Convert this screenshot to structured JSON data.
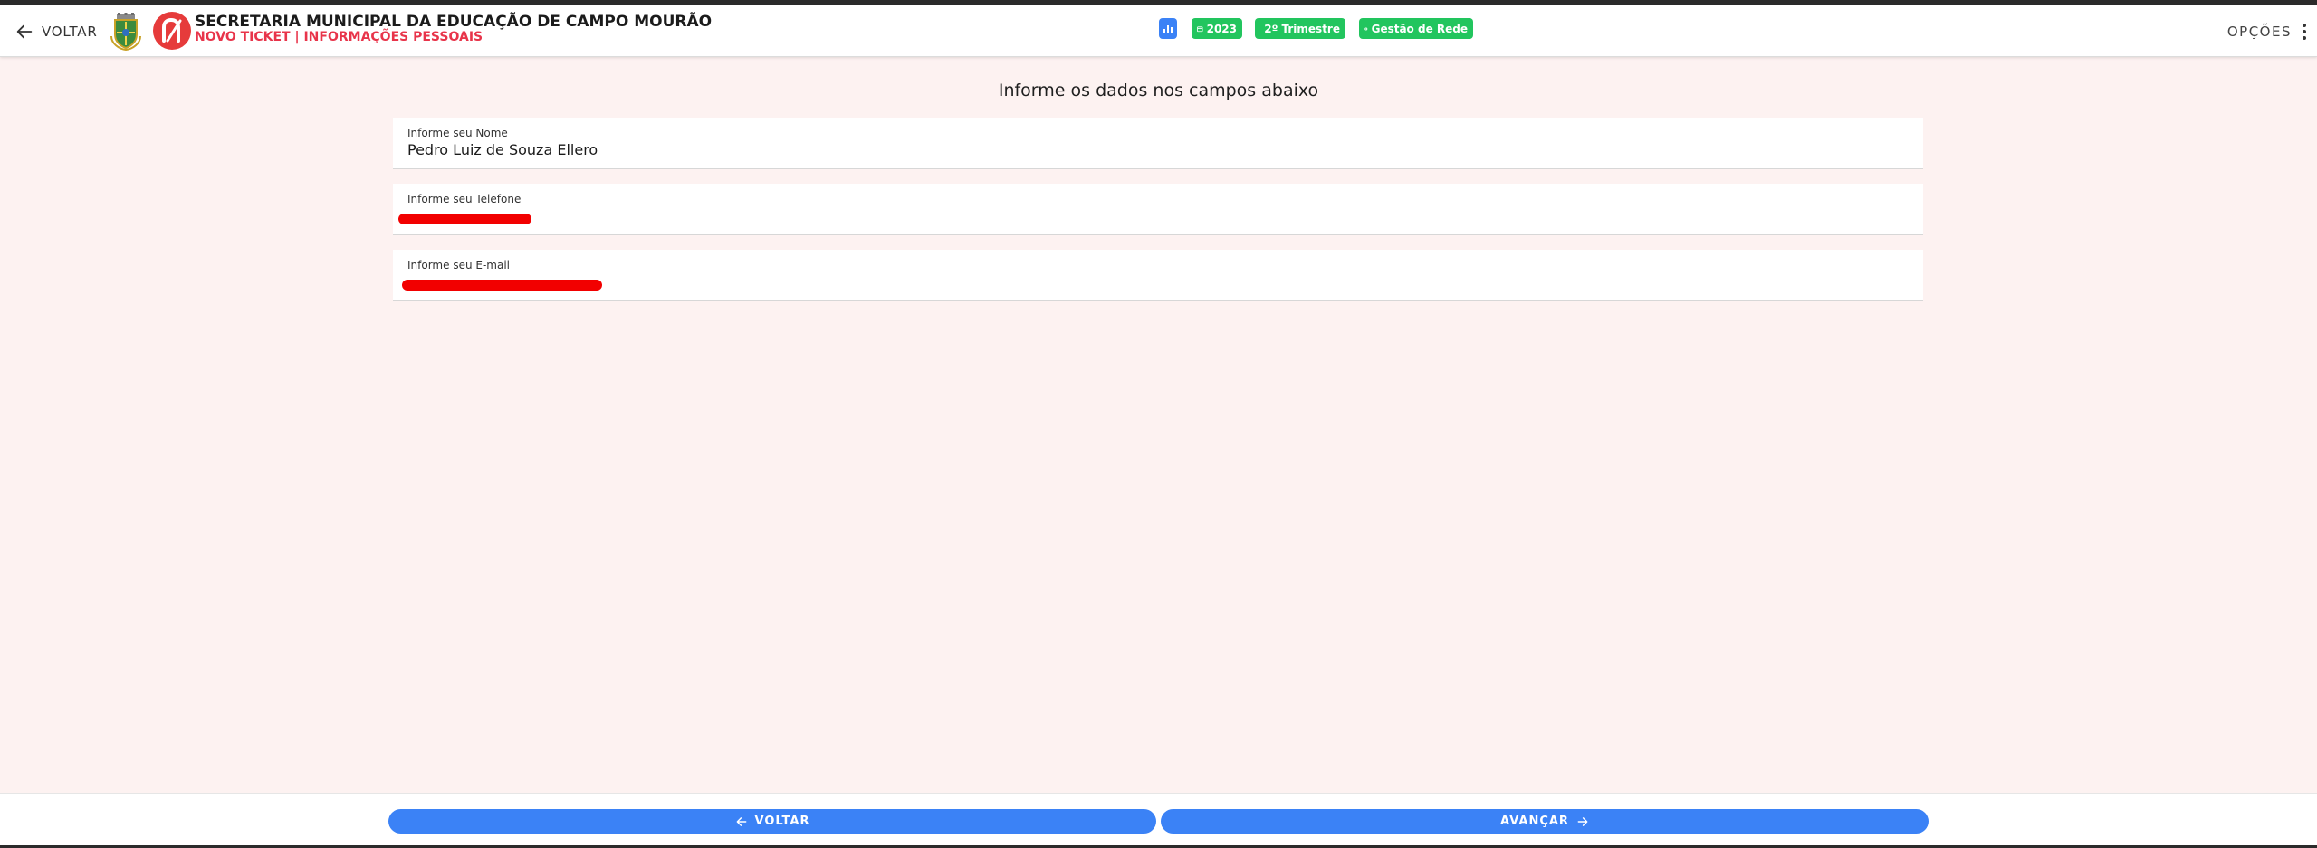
{
  "header": {
    "back_label": "VOLTAR",
    "title": "SECRETARIA MUNICIPAL DA EDUCAÇÃO DE CAMPO MOURÃO",
    "subtitle": "NOVO TICKET | INFORMAÇÕES PESSOAIS",
    "chips": {
      "year": "2023",
      "term": "2º Trimestre",
      "network": "Gestão de Rede"
    },
    "options_label": "OPÇÕES"
  },
  "form": {
    "title": "Informe os dados nos campos abaixo",
    "name_label": "Informe seu Nome",
    "name_value": "Pedro Luiz de Souza Ellero",
    "phone_label": "Informe seu Telefone",
    "email_label": "Informe seu E-mail"
  },
  "footer": {
    "back_label": "VOLTAR",
    "next_label": "AVANÇAR"
  },
  "colors": {
    "accent_blue": "#3b82f6",
    "chip_green": "#22c55e",
    "subtitle_red": "#e8344a",
    "page_background": "#fdf2f1",
    "logo_red": "#e63b3b"
  },
  "icons": {
    "back": "arrow-left-icon",
    "stats": "bar-chart-icon",
    "calendar": "calendar-icon",
    "network": "network-icon",
    "options": "more-vertical-icon",
    "next": "arrow-right-icon"
  }
}
